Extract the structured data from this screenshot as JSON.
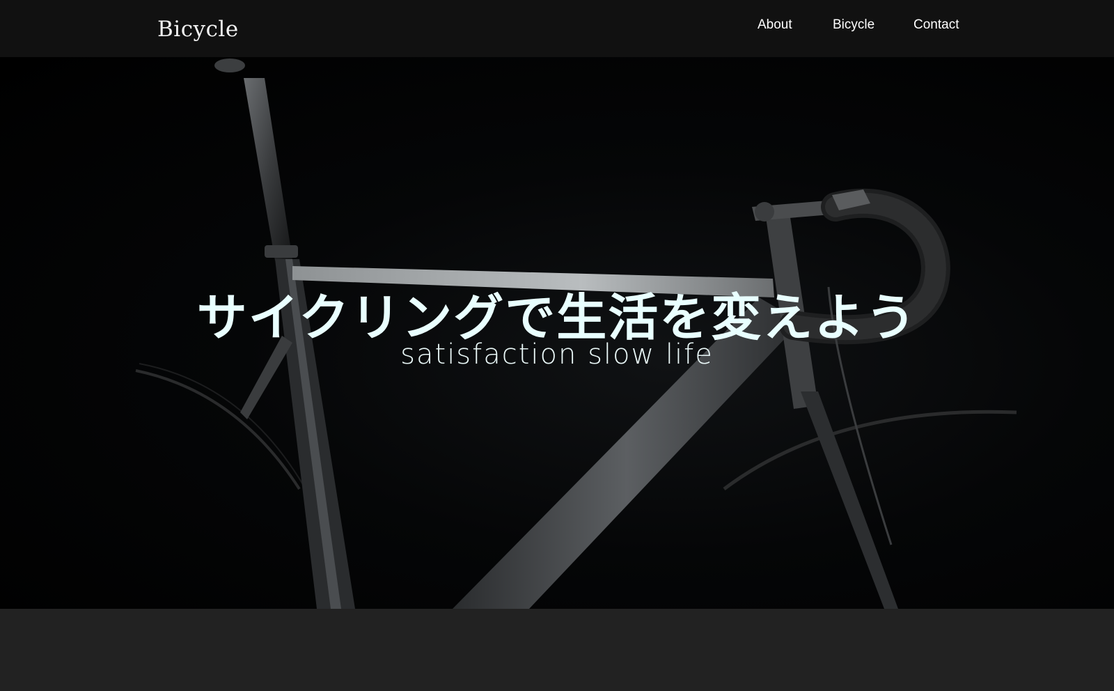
{
  "header": {
    "brand": "Bicycle",
    "nav": [
      {
        "label": "About"
      },
      {
        "label": "Bicycle"
      },
      {
        "label": "Contact"
      }
    ]
  },
  "hero": {
    "title": "サイクリングで生活を変えよう",
    "subtitle": "satisfaction slow life"
  },
  "colors": {
    "header_bg": "#111111",
    "page_bg": "#222222",
    "hero_text": "#e9ffff"
  }
}
